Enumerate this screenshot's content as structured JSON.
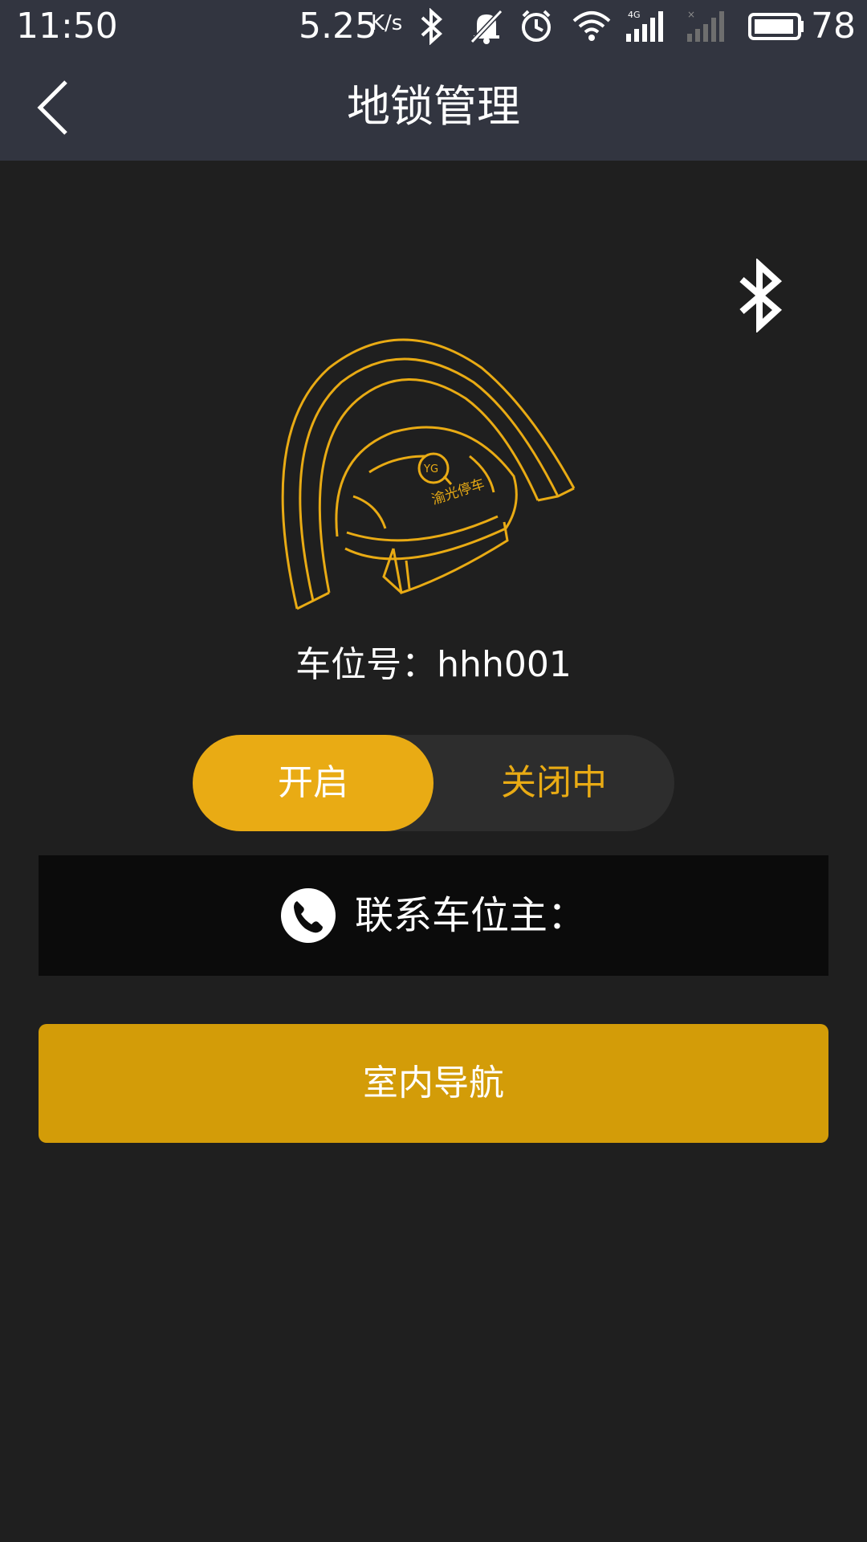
{
  "status_bar": {
    "time": "11:50",
    "net_speed": "5.25",
    "net_speed_unit": "K/s",
    "battery": "78",
    "icons": [
      "bluetooth-icon",
      "mute-icon",
      "alarm-icon",
      "wifi-icon",
      "signal-4g-icon",
      "signal-empty-icon",
      "battery-icon"
    ]
  },
  "app_bar": {
    "title": "地锁管理",
    "back_icon": "chevron-left-icon"
  },
  "main": {
    "bluetooth_icon": "bluetooth-icon",
    "lock_image_text": "渝光停车",
    "lock_badge_text": "YG",
    "spot_label": "车位号：hhh001",
    "toggle": {
      "on_label": "开启",
      "off_label": "关闭中"
    },
    "contact": {
      "icon": "phone-icon",
      "label": "联系车位主："
    },
    "nav_button_label": "室内导航"
  },
  "colors": {
    "accent": "#e9ab14",
    "nav_button": "#d39c08",
    "header": "#323540",
    "background": "#1f1f1f",
    "contact_bar": "#0b0b0b"
  }
}
